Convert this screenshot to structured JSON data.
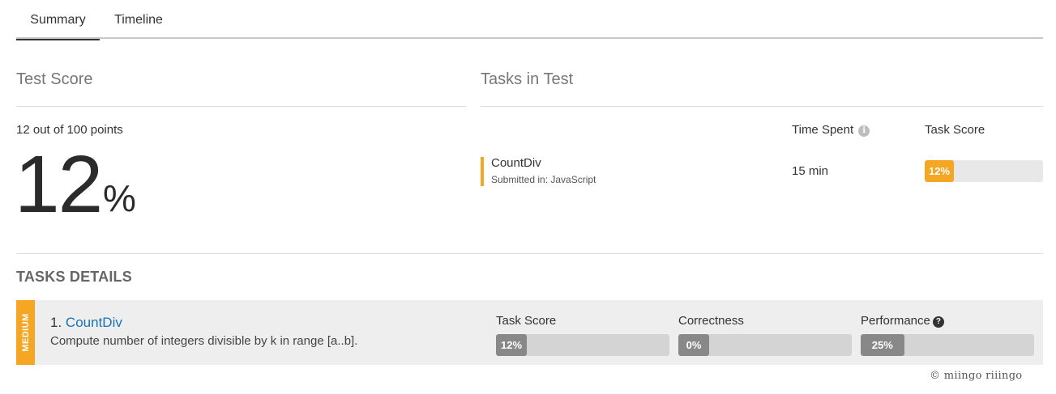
{
  "tabs": [
    {
      "label": "Summary",
      "active": true
    },
    {
      "label": "Timeline",
      "active": false
    }
  ],
  "test_score": {
    "title": "Test Score",
    "points_text": "12 out of 100 points",
    "score_value": "12",
    "percent_sign": "%"
  },
  "tasks_in_test": {
    "title": "Tasks in Test",
    "col_time_spent": "Time Spent",
    "col_task_score": "Task Score",
    "task": {
      "name": "CountDiv",
      "submitted": "Submitted in: JavaScript",
      "time_spent": "15 min",
      "score_label": "12%",
      "score_percent": 12
    }
  },
  "tasks_details": {
    "title": "TASKS DETAILS",
    "task": {
      "difficulty": "MEDIUM",
      "number": "1.",
      "name": "CountDiv",
      "description": "Compute number of integers divisible by k in range [a..b].",
      "metrics": [
        {
          "label": "Task Score",
          "value_label": "12%",
          "percent": 12
        },
        {
          "label": "Correctness",
          "value_label": "0%",
          "percent": 0
        },
        {
          "label": "Performance",
          "value_label": "25%",
          "percent": 25
        }
      ]
    }
  },
  "copyright": "© miingo riiingo",
  "colors": {
    "accent": "#f5a623",
    "link": "#1a73b5",
    "metric_fill": "#888888"
  }
}
